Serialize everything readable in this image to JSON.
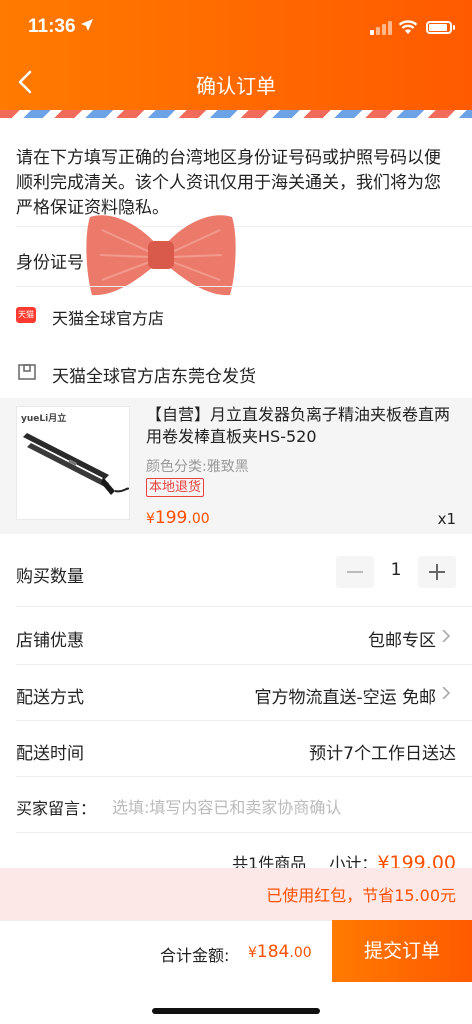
{
  "status_bar": {
    "time": "11:36",
    "signal_bars": 1,
    "battery_level": 0.8
  },
  "nav": {
    "title": "确认订单"
  },
  "notice": {
    "text": "请在下方填写正确的台湾地区身份证号码或护照号码以便顺利完成清关。该个人资讯仅用于海关通关，我们将为您严格保证资料隐私。"
  },
  "id_field": {
    "label": "身份证号"
  },
  "store": {
    "badge": "天猫",
    "name": "天猫全球官方店"
  },
  "warehouse": {
    "label": "天猫全球官方店东莞仓发货"
  },
  "product": {
    "title": "【自营】月立直发器负离子精油夹板卷直两用卷发棒直板夹HS-520",
    "variant": "颜色分类:雅致黑",
    "tag": "本地退货",
    "price_currency": "¥",
    "price_int": "199",
    "price_dec": ".00",
    "quantity_mark": "x1",
    "brand_logo": "yueLi月立"
  },
  "quantity": {
    "label": "购买数量",
    "value": "1"
  },
  "shop_discount": {
    "label": "店铺优惠",
    "value": "包邮专区"
  },
  "shipping": {
    "label": "配送方式",
    "value": "官方物流直送-空运 免邮"
  },
  "delivery_time": {
    "label": "配送时间",
    "value": "预计7个工作日送达"
  },
  "message": {
    "label": "买家留言：",
    "placeholder": "选填:填写内容已和卖家协商确认"
  },
  "summary": {
    "count_text": "共1件商品",
    "subtotal_label": "小计：",
    "subtotal_amount": "¥199.00"
  },
  "red_packet": {
    "text": "已使用红包，节省15.00元"
  },
  "footer": {
    "total_label": "合计金额:",
    "total_currency": "¥",
    "total_int": "184",
    "total_dec": ".00",
    "submit_label": "提交订单"
  },
  "colors": {
    "accent": "#ff5a00",
    "price": "#ff5000",
    "tag_red": "#e64340",
    "red_packet_bg": "#fde8e8"
  },
  "icons": [
    "location-arrow-icon",
    "signal-icon",
    "wifi-icon",
    "battery-icon",
    "back-arrow-icon",
    "tmall-badge-icon",
    "warehouse-icon",
    "chevron-right-icon",
    "minus-icon",
    "plus-icon"
  ]
}
